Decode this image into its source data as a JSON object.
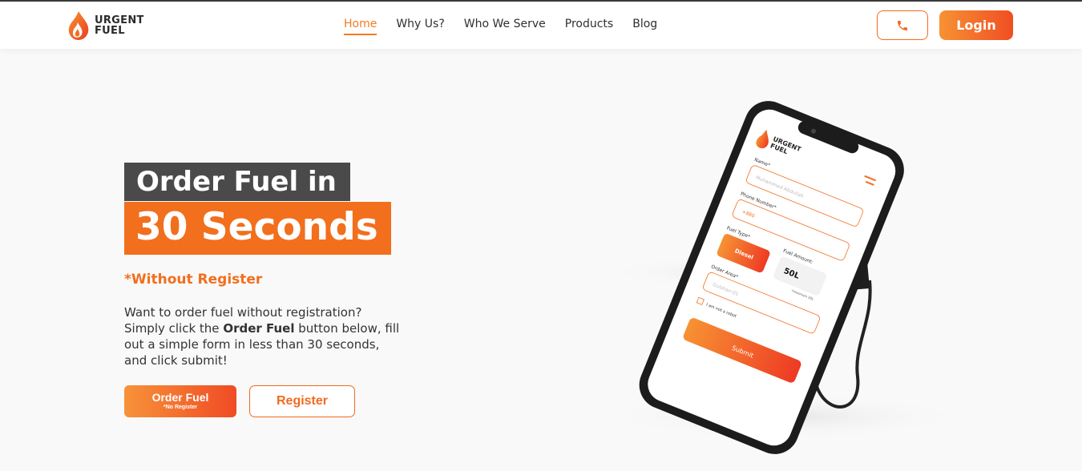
{
  "header": {
    "logo_line1": "URGENT",
    "logo_line2": "FUEL",
    "nav": [
      {
        "label": "Home",
        "active": true
      },
      {
        "label": "Why Us?",
        "active": false
      },
      {
        "label": "Who We Serve",
        "active": false
      },
      {
        "label": "Products",
        "active": false
      },
      {
        "label": "Blog",
        "active": false
      }
    ],
    "login_label": "Login",
    "phone_icon": "phone-icon"
  },
  "hero": {
    "title_line1": "Order Fuel in",
    "title_line2": "30 Seconds",
    "subtitle": "*Without Register",
    "description_part1": "Want to order fuel without registration? Simply click the ",
    "description_bold": "Order Fuel",
    "description_part2": " button below, fill out a simple form in less than 30 seconds, and click submit!",
    "order_button": "Order Fuel",
    "order_button_sub": "*No Register",
    "register_button": "Register"
  },
  "phone_mockup": {
    "logo_line1": "URGENT",
    "logo_line2": "FUEL",
    "name_label": "Name*",
    "name_placeholder": "Muhammad Abdullah",
    "phone_label": "Phone Number*",
    "phone_prefix": "+880",
    "fuel_type_label": "Fuel Type*",
    "fuel_type_value": "Diesel",
    "fuel_amount_label": "Fuel Amount:",
    "fuel_amount_value": "50L",
    "fuel_amount_min": "*minimum 20L",
    "order_area_label": "Order Area*",
    "order_area_placeholder": "Gulshan-01",
    "robot_label": "I am not a robot",
    "submit_label": "Submit"
  },
  "colors": {
    "accent": "#f26f1d",
    "dark_block": "#4a4a4a",
    "gradient_start": "#f79233",
    "gradient_end": "#f04e23"
  }
}
